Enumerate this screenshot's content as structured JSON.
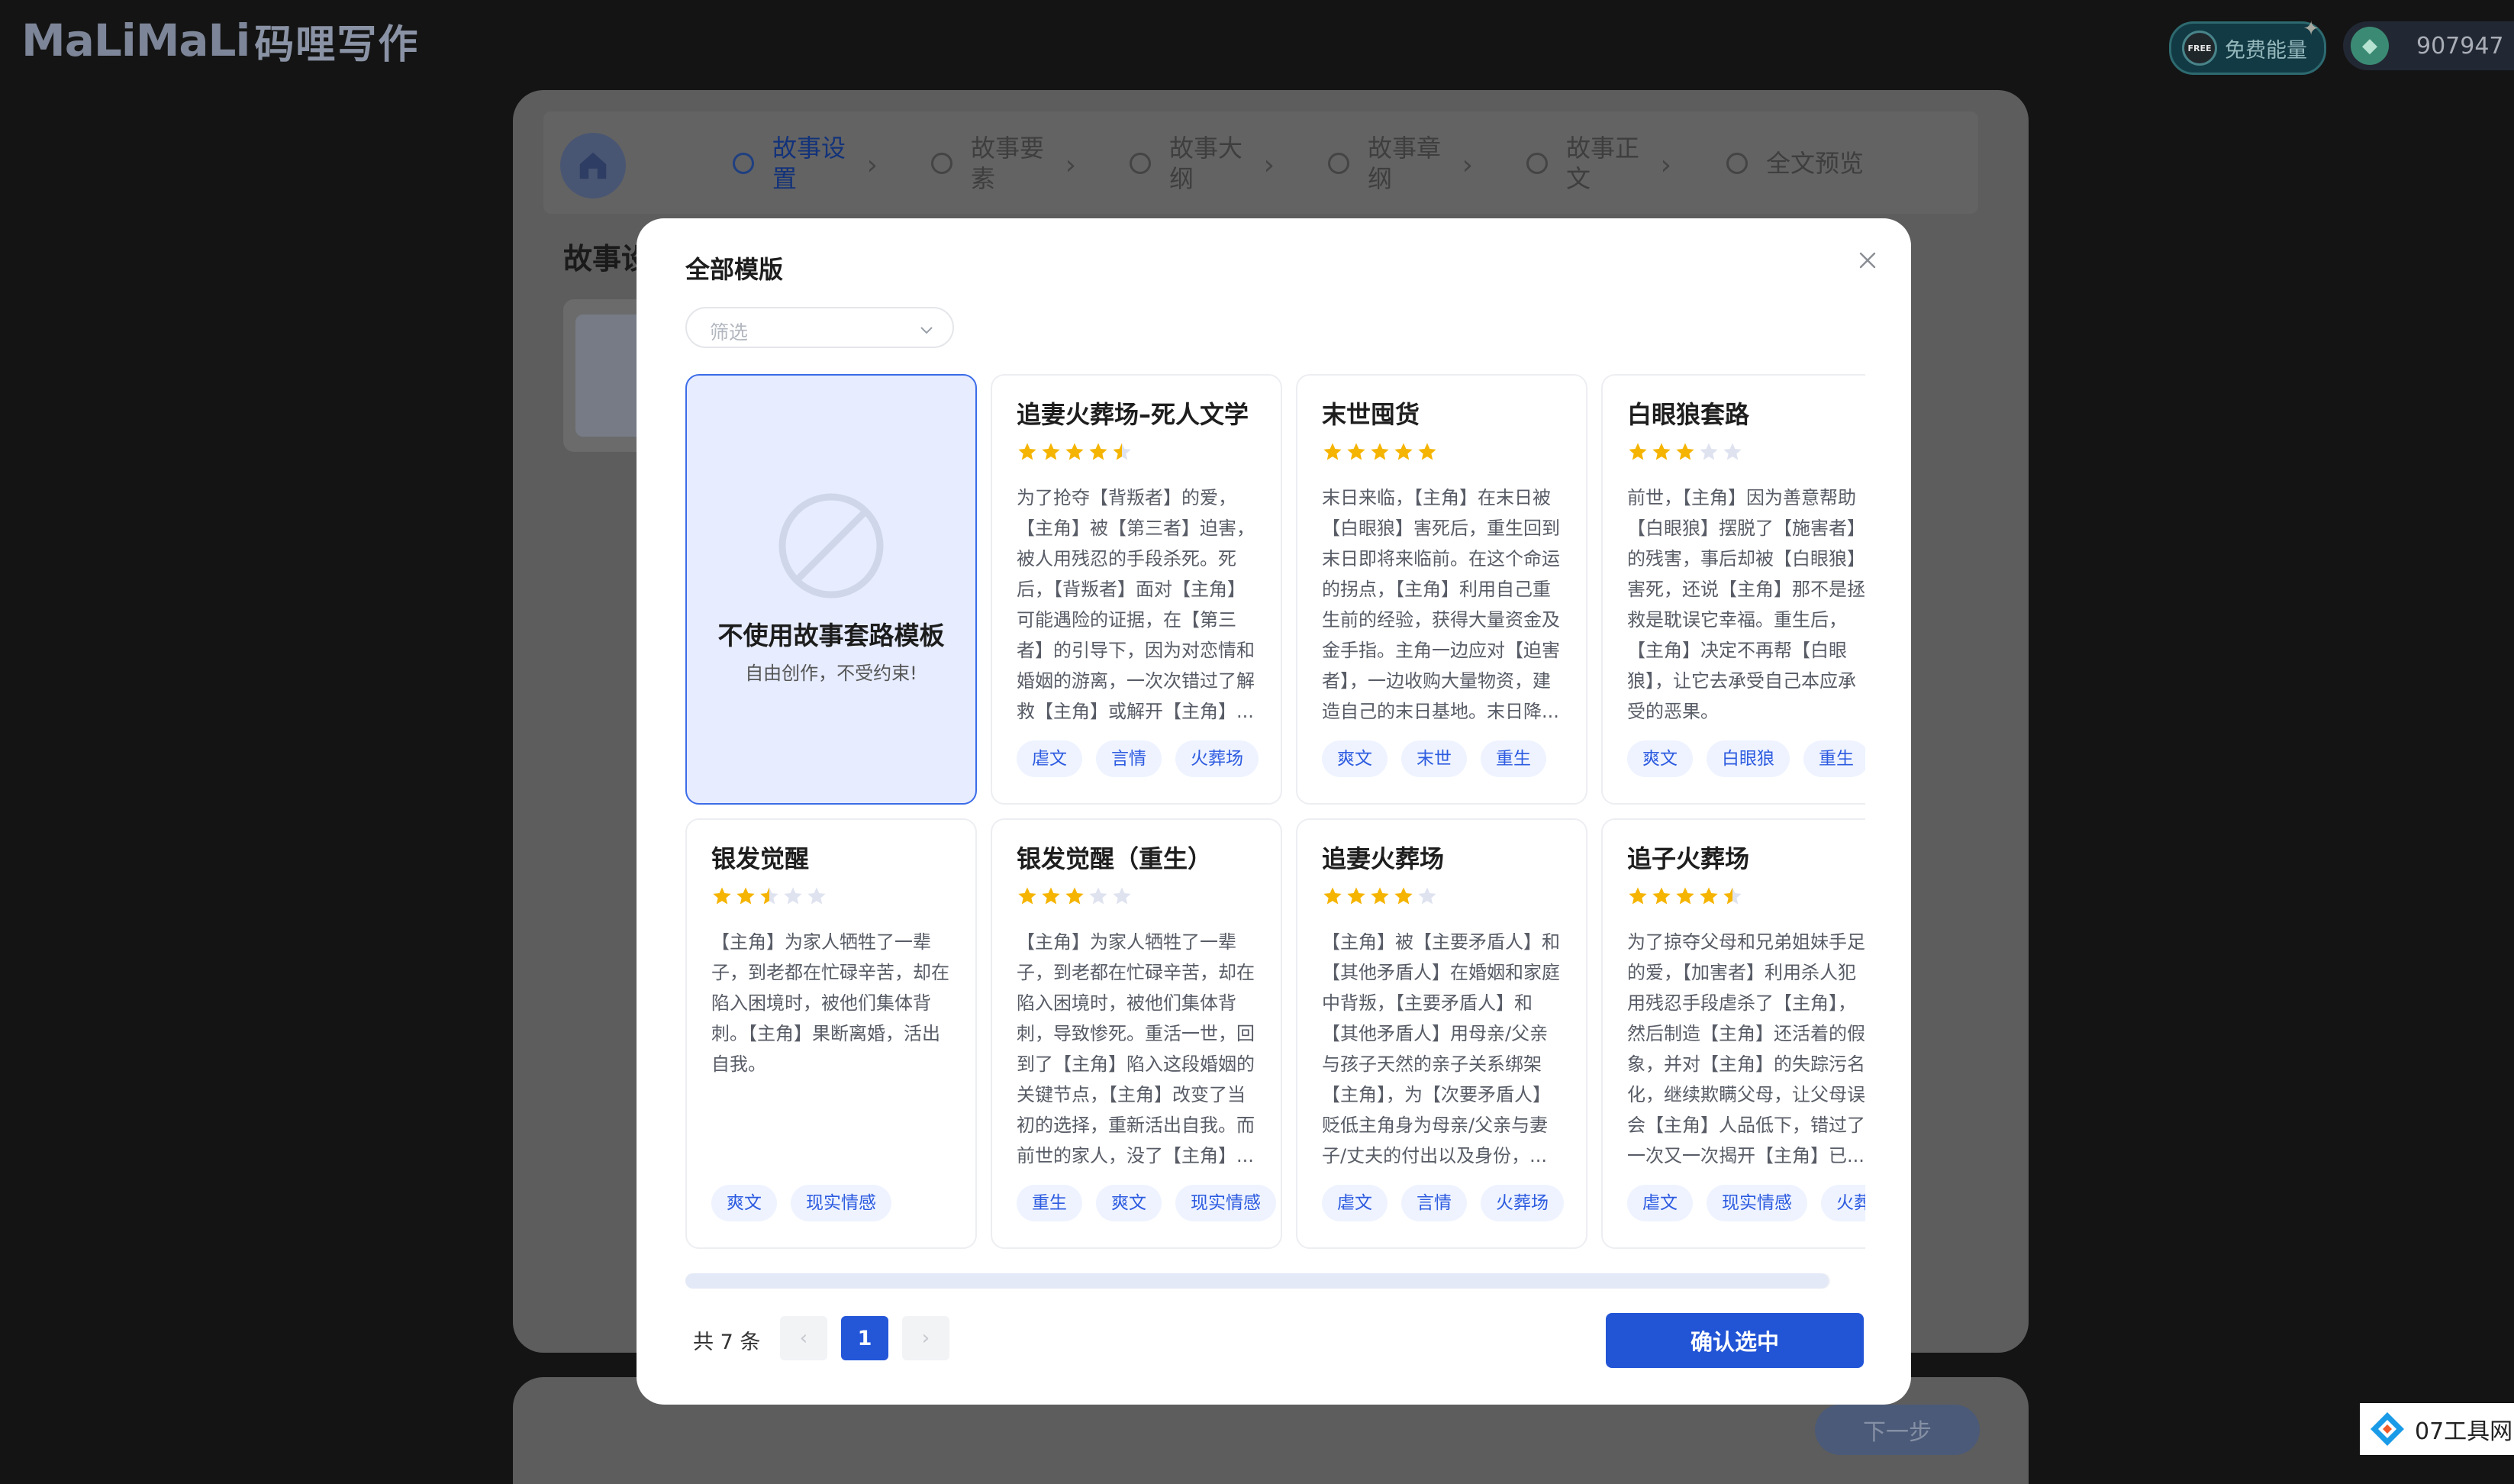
{
  "app": {
    "logo_latin": "MaLiMaLi",
    "logo_cn": "码哩写作"
  },
  "topbar": {
    "free_energy_label": "免费能量",
    "free_badge": "FREE",
    "coins": "907947"
  },
  "steps": [
    {
      "label": "故事设置",
      "active": true
    },
    {
      "label": "故事要素",
      "active": false
    },
    {
      "label": "故事大纲",
      "active": false
    },
    {
      "label": "故事章纲",
      "active": false
    },
    {
      "label": "故事正文",
      "active": false
    },
    {
      "label": "全文预览",
      "active": false
    }
  ],
  "background": {
    "section_title": "故事设",
    "next_label": "下一步"
  },
  "modal": {
    "title": "全部模版",
    "filter_placeholder": "筛选",
    "no_template": {
      "title": "不使用故事套路模板",
      "subtitle": "自由创作，不受约束!"
    },
    "cards": [
      {
        "title": "追妻火葬场–死人文学",
        "rating": 4.5,
        "desc": "为了抢夺【背叛者】的爱，【主角】被【第三者】迫害，被人用残忍的手段杀死。死后，【背叛者】面对【主角】可能遇险的证据，在【第三者】的引导下，因为对恋情和婚姻的游离，一次次错过了解救【主角】或解开【主角】...",
        "tags": [
          "虐文",
          "言情",
          "火葬场"
        ]
      },
      {
        "title": "末世囤货",
        "rating": 5,
        "desc": "末日来临，【主角】在末日被【白眼狼】害死后，重生回到末日即将来临前。在这个命运的拐点，【主角】利用自己重生前的经验，获得大量资金及金手指。主角一边应对【迫害者】，一边收购大量物资，建造自己的末日基地。末日降...",
        "tags": [
          "爽文",
          "末世",
          "重生"
        ]
      },
      {
        "title": "白眼狼套路",
        "rating": 3,
        "desc": "前世，【主角】因为善意帮助【白眼狼】摆脱了【施害者】的残害，事后却被【白眼狼】害死，还说【主角】那不是拯救是耽误它幸福。重生后，【主角】决定不再帮【白眼狼】，让它去承受自己本应承受的恶果。",
        "tags": [
          "爽文",
          "白眼狼",
          "重生"
        ]
      },
      {
        "title": "银发觉醒",
        "rating": 2.5,
        "desc": "【主角】为家人牺牲了一辈子，到老都在忙碌辛苦，却在陷入困境时，被他们集体背刺。【主角】果断离婚，活出自我。",
        "tags": [
          "爽文",
          "现实情感"
        ]
      },
      {
        "title": "银发觉醒（重生）",
        "rating": 3,
        "desc": "【主角】为家人牺牲了一辈子，到老都在忙碌辛苦，却在陷入困境时，被他们集体背刺，导致惨死。重活一世，回到了【主角】陷入这段婚姻的关键节点，【主角】改变了当初的选择，重新活出自我。而前世的家人，没了【主角】...",
        "tags": [
          "重生",
          "爽文",
          "现实情感"
        ]
      },
      {
        "title": "追妻火葬场",
        "rating": 4,
        "desc": "【主角】被【主要矛盾人】和【其他矛盾人】在婚姻和家庭中背叛，【主要矛盾人】和【其他矛盾人】用母亲/父亲与孩子天然的亲子关系绑架【主角】，为【次要矛盾人】贬低主角身为母亲/父亲与妻子/丈夫的付出以及身份，...",
        "tags": [
          "虐文",
          "言情",
          "火葬场"
        ]
      },
      {
        "title": "追子火葬场",
        "rating": 4.5,
        "desc": "为了掠夺父母和兄弟姐妹手足的爱，【加害者】利用杀人犯用残忍手段虐杀了【主角】，然后制造【主角】还活着的假象，并对【主角】的失踪污名化，继续欺瞒父母，让父母误会【主角】人品低下，错过了一次又一次揭开【主角】已...",
        "tags": [
          "虐文",
          "现实情感",
          "火葬场"
        ]
      }
    ],
    "pagination": {
      "total_text": "共 7 条",
      "current_page": "1",
      "prev": "‹",
      "next": "›"
    },
    "confirm_label": "确认选中"
  },
  "watermark": {
    "text": "07工具网"
  },
  "colors": {
    "primary": "#2254d6",
    "star": "#f5b400",
    "star_empty": "#dfe3f0",
    "tag_bg": "#eef3ff"
  }
}
